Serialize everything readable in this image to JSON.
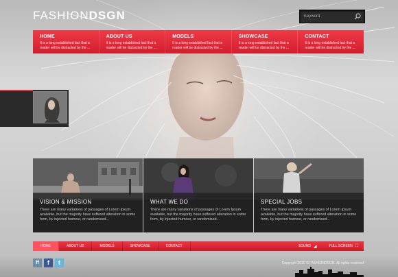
{
  "logo": {
    "part1": "FASHION",
    "part2": "DSGN"
  },
  "search": {
    "placeholder": "Keyword"
  },
  "topnav": [
    {
      "title": "HOME",
      "desc": "It is a long established fact that a reader will be distracted by the ..."
    },
    {
      "title": "ABOUT US",
      "desc": "It is a long established fact that a reader will be distracted by the ..."
    },
    {
      "title": "MODELS",
      "desc": "It is a long established fact that a reader will be distracted by the ..."
    },
    {
      "title": "SHOWCASE",
      "desc": "It is a long established fact that a reader will be distracted by the ..."
    },
    {
      "title": "CONTACT",
      "desc": "It is a long established fact that a reader will be distracted by the ..."
    }
  ],
  "cards": [
    {
      "title": "VISION & MISSION",
      "text": "There are many variations of passages of Lorem Ipsum available, but the majority have suffered alteration in some form, by injected humour, or randomised..."
    },
    {
      "title": "WHAT WE DO",
      "text": "There are many variations of passages of Lorem Ipsum available, but the majority have suffered alteration in some form, by injected humour, or randomised..."
    },
    {
      "title": "SPECIAL JOBS",
      "text": "There are many variations of passages of Lorem Ipsum available, but the majority have suffered alteration in some form, by injected humour, or randomised..."
    }
  ],
  "botnav": {
    "links": [
      "HOME",
      "ABOUT US",
      "MODELS",
      "SHOWCASE",
      "CONTACT"
    ],
    "active_index": 0,
    "sound": "SOUND",
    "fullscreen": "FULL SCREEN"
  },
  "social": {
    "ff": "ff",
    "fb": "f",
    "tw": "t"
  },
  "copyright": "Copyright 2010 © FASHIONDSGN. All rights reserved",
  "colors": {
    "accent": "#e62b3a",
    "dark": "#1b1b1b"
  }
}
